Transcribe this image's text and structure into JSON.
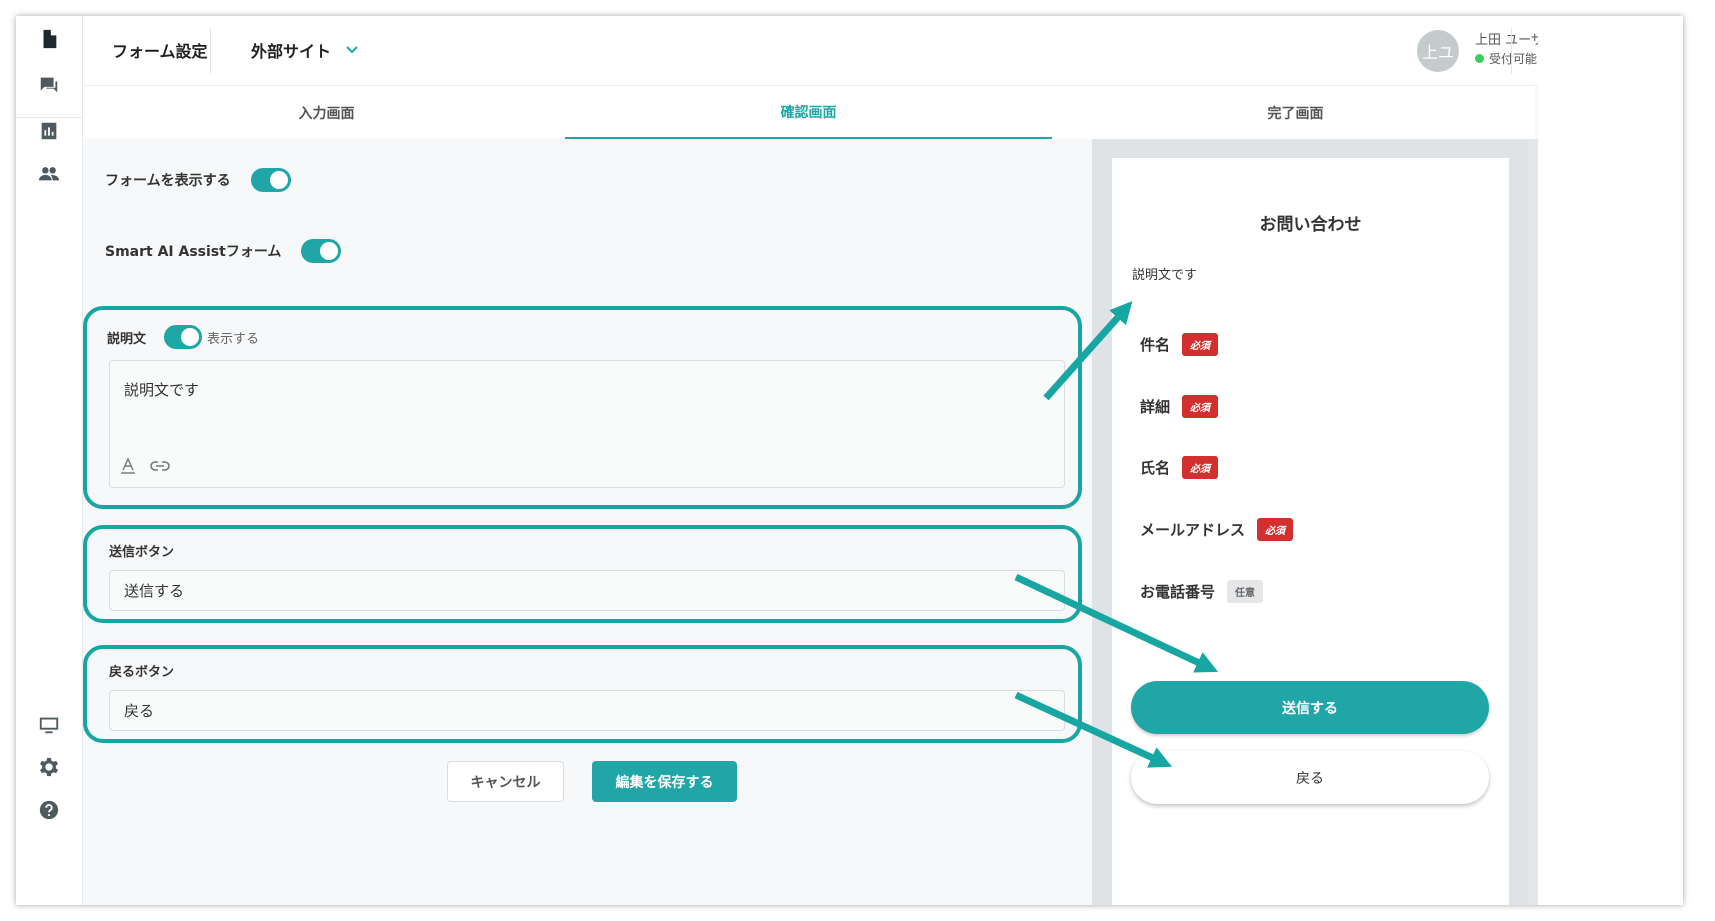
{
  "header": {
    "form_settings": "フォーム設定",
    "site_select": "外部サイト",
    "avatar_initials": "上ユ",
    "user_name": "上田 ユーザー",
    "user_status": "受付可能"
  },
  "rail": {
    "items": [
      "document-icon",
      "chat-icon",
      "chart-icon",
      "users-icon",
      "monitor-icon",
      "gear-icon",
      "help-icon"
    ]
  },
  "tabs": [
    {
      "label": "入力画面",
      "active": false
    },
    {
      "label": "確認画面",
      "active": true
    },
    {
      "label": "完了画面",
      "active": false
    }
  ],
  "form": {
    "show_form_label": "フォームを表示する",
    "show_form_on": true,
    "ai_assist_label": "Smart AI Assistフォーム",
    "ai_assist_on": true,
    "description": {
      "label": "説明文",
      "toggle_label": "表示する",
      "toggle_on": true,
      "value": "説明文です"
    },
    "submit_button": {
      "label": "送信ボタン",
      "value": "送信する"
    },
    "back_button": {
      "label": "戻るボタン",
      "value": "戻る"
    },
    "cancel_label": "キャンセル",
    "save_label": "編集を保存する"
  },
  "preview": {
    "title": "お問い合わせ",
    "description": "説明文です",
    "fields": [
      {
        "label": "件名",
        "badge": "必須",
        "required": true
      },
      {
        "label": "詳細",
        "badge": "必須",
        "required": true
      },
      {
        "label": "氏名",
        "badge": "必須",
        "required": true
      },
      {
        "label": "メールアドレス",
        "badge": "必須",
        "required": true
      },
      {
        "label": "お電話番号",
        "badge": "任意",
        "required": false
      }
    ],
    "submit_label": "送信する",
    "back_label": "戻る"
  },
  "colors": {
    "accent": "#20a6a6",
    "highlight_border": "#17a6a2",
    "required_badge": "#d32f2f",
    "status_online": "#3ccf5b"
  }
}
